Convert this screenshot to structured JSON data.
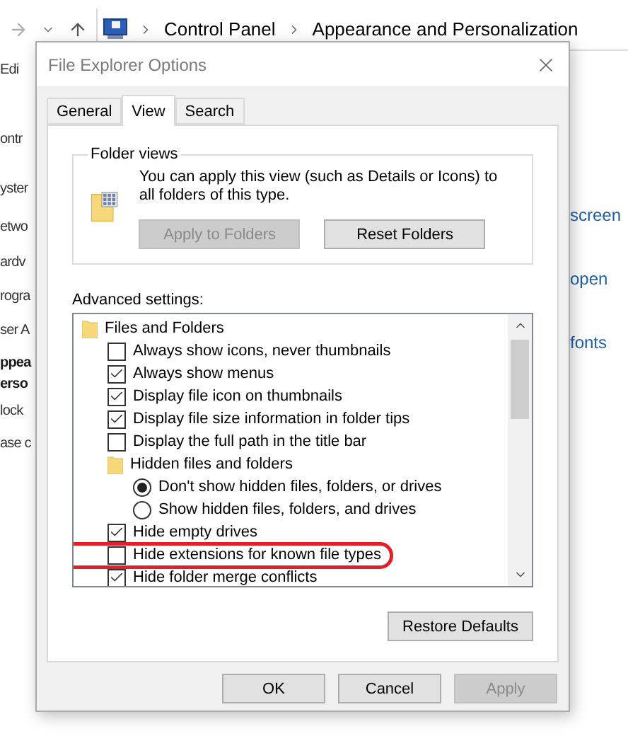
{
  "explorer": {
    "breadcrumb": [
      "Control Panel",
      "Appearance and Personalization"
    ],
    "left_fragments": [
      {
        "text": "Edi",
        "bold": false
      },
      {
        "text": "ontr",
        "bold": false
      },
      {
        "text": "yster",
        "bold": false
      },
      {
        "text": "etwo",
        "bold": false
      },
      {
        "text": "ardv",
        "bold": false
      },
      {
        "text": "rogra",
        "bold": false
      },
      {
        "text": "ser A",
        "bold": false
      },
      {
        "text": "ppea",
        "bold": true
      },
      {
        "text": "erso",
        "bold": true
      },
      {
        "text": "lock",
        "bold": false
      },
      {
        "text": "ase c",
        "bold": false
      }
    ],
    "right_links": [
      "screen",
      "open",
      "fonts"
    ]
  },
  "dialog": {
    "title": "File Explorer Options",
    "tabs": [
      {
        "label": "General",
        "selected": false
      },
      {
        "label": "View",
        "selected": true
      },
      {
        "label": "Search",
        "selected": false
      }
    ],
    "folder_views": {
      "legend": "Folder views",
      "description": "You can apply this view (such as Details or Icons) to all folders of this type.",
      "buttons": [
        {
          "label": "Apply to Folders",
          "disabled": true
        },
        {
          "label": "Reset Folders",
          "disabled": false
        }
      ]
    },
    "advanced_label": "Advanced settings:",
    "tree": [
      {
        "kind": "folder",
        "label": "Files and Folders",
        "children": [
          {
            "kind": "checkbox",
            "label": "Always show icons, never thumbnails",
            "checked": false
          },
          {
            "kind": "checkbox",
            "label": "Always show menus",
            "checked": true
          },
          {
            "kind": "checkbox",
            "label": "Display file icon on thumbnails",
            "checked": true
          },
          {
            "kind": "checkbox",
            "label": "Display file size information in folder tips",
            "checked": true
          },
          {
            "kind": "checkbox",
            "label": "Display the full path in the title bar",
            "checked": false
          },
          {
            "kind": "folder",
            "label": "Hidden files and folders",
            "children": [
              {
                "kind": "radio",
                "label": "Don't show hidden files, folders, or drives",
                "selected": true
              },
              {
                "kind": "radio",
                "label": "Show hidden files, folders, and drives",
                "selected": false
              }
            ]
          },
          {
            "kind": "checkbox",
            "label": "Hide empty drives",
            "checked": true
          },
          {
            "kind": "checkbox",
            "label": "Hide extensions for known file types",
            "checked": false,
            "circled": true
          },
          {
            "kind": "checkbox",
            "label": "Hide folder merge conflicts",
            "checked": true
          }
        ]
      }
    ],
    "restore_button": "Restore Defaults",
    "buttons": [
      {
        "label": "OK",
        "disabled": false
      },
      {
        "label": "Cancel",
        "disabled": false
      },
      {
        "label": "Apply",
        "disabled": true
      }
    ]
  }
}
